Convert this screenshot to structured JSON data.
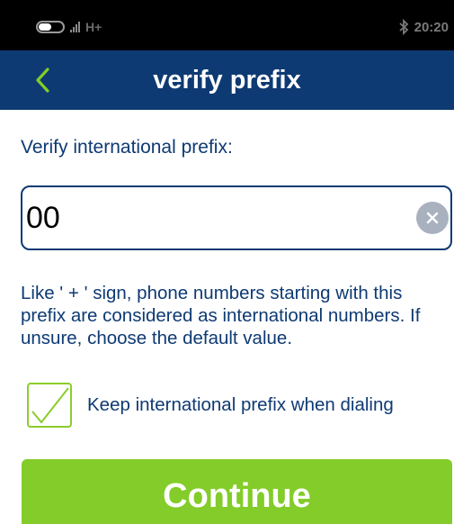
{
  "status_bar": {
    "network_type": "H+",
    "time": "20:20",
    "icons": [
      "toggle-icon",
      "signal-icon",
      "bluetooth-icon"
    ]
  },
  "header": {
    "title": "verify prefix",
    "back_icon": "chevron-left-icon",
    "background_color": "#0e3a73"
  },
  "main": {
    "prefix_label": "Verify international prefix:",
    "prefix_input": {
      "value": "00",
      "placeholder": ""
    },
    "help_text": "Like ' + ' sign, phone numbers starting with this prefix are considered as international numbers. If unsure, choose the default value.",
    "keep_prefix_checkbox": {
      "label": "Keep international prefix when dialing",
      "checked": true
    },
    "continue_label": "Continue"
  },
  "colors": {
    "accent_green": "#83cc29",
    "text_blue": "#0e3a73",
    "clear_button_gray": "#a9b1bf"
  }
}
